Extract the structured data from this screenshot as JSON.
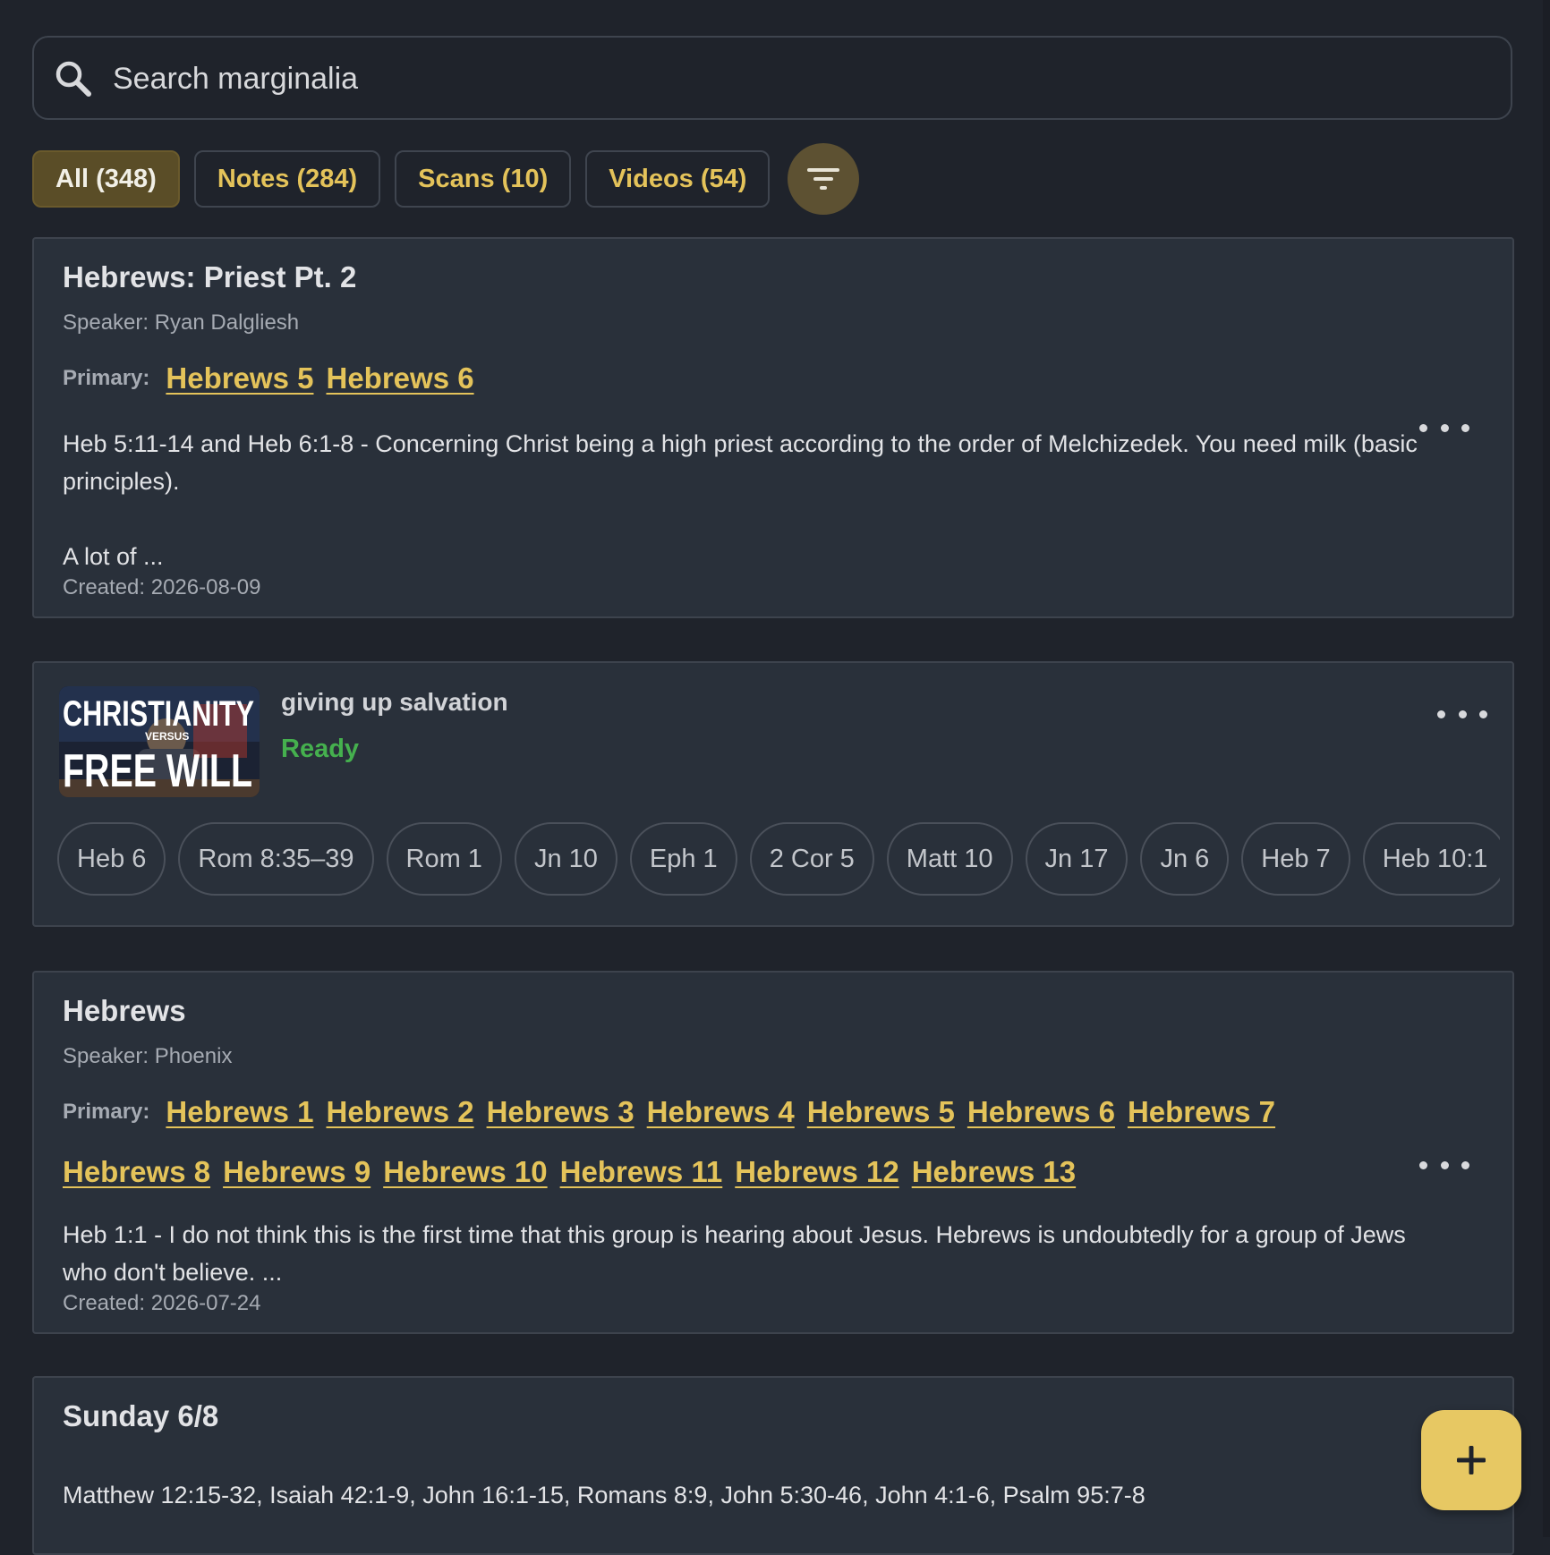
{
  "search": {
    "placeholder": "Search marginalia"
  },
  "filters": {
    "chips": [
      {
        "label": "All (348)",
        "active": true
      },
      {
        "label": "Notes (284)",
        "active": false
      },
      {
        "label": "Scans (10)",
        "active": false
      },
      {
        "label": "Videos (54)",
        "active": false
      }
    ],
    "filter_icon": "filter-icon"
  },
  "colors": {
    "background": "#1f232b",
    "card": "#29303a",
    "accent": "#e4c35a",
    "active_chip": "#5a4d27",
    "ready": "#45b04e",
    "fab": "#e7c863"
  },
  "cards": [
    {
      "type": "note",
      "title": "Hebrews: Priest Pt. 2",
      "speaker": "Speaker: Ryan Dalgliesh",
      "primary_label": "Primary:",
      "refs": [
        "Hebrews 5",
        "Hebrews 6"
      ],
      "body_line1": "Heb 5:11-14 and Heb 6:1-8 - Concerning Christ being a high priest according to the order of Melchizedek. You need milk (basic principles).",
      "body_line2": "A lot of ...",
      "created": "Created: 2026-08-09"
    },
    {
      "type": "video",
      "title": "giving up salvation",
      "status": "Ready",
      "thumbnail": {
        "line1": "CHRISTIANITY",
        "line2": "VERSUS",
        "line3": "FREE WILL"
      },
      "refs": [
        "Heb 6",
        "Rom 8:35–39",
        "Rom 1",
        "Jn 10",
        "Eph 1",
        "2 Cor 5",
        "Matt 10",
        "Jn 17",
        "Jn 6",
        "Heb 7",
        "Heb 10:1"
      ]
    },
    {
      "type": "note",
      "title": "Hebrews",
      "speaker": "Speaker: Phoenix",
      "primary_label": "Primary:",
      "refs": [
        "Hebrews 1",
        "Hebrews 2",
        "Hebrews 3",
        "Hebrews 4",
        "Hebrews 5",
        "Hebrews 6",
        "Hebrews 7",
        "Hebrews 8",
        "Hebrews 9",
        "Hebrews 10",
        "Hebrews 11",
        "Hebrews 12",
        "Hebrews 13"
      ],
      "body": "Heb 1:1 - I do not think this is the first time that this group is hearing about Jesus. Hebrews is undoubtedly for a group of Jews who don't believe. ...",
      "created": "Created: 2026-07-24"
    },
    {
      "type": "note",
      "title": "Sunday 6/8",
      "body": "Matthew 12:15-32, Isaiah 42:1-9, John 16:1-15, Romans 8:9, John 5:30-46, John 4:1-6, Psalm 95:7-8"
    }
  ],
  "fab": {
    "icon": "plus-icon",
    "glyph": "+"
  }
}
